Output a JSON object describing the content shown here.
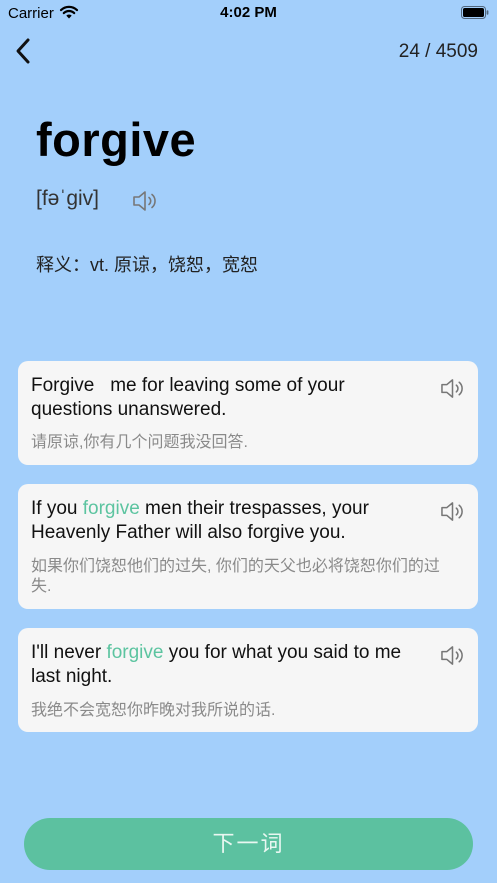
{
  "status_bar": {
    "carrier": "Carrier",
    "time": "4:02 PM"
  },
  "header": {
    "counter": "24 / 4509"
  },
  "word": {
    "text": "forgive",
    "phonetic": "[fəˈgiv]",
    "meaning_label": "释义：",
    "meaning_text": "vt. 原谅，饶恕，宽恕"
  },
  "examples": [
    {
      "en_before": "Forgive",
      "en_highlight": "",
      "en_after": "me  for leaving some of your questions unanswered.",
      "zh": "请原谅,你有几个问题我没回答."
    },
    {
      "en_before": "If you ",
      "en_highlight": "forgive",
      "en_after": " men their trespasses, your Heavenly Father will also forgive you.",
      "zh": "如果你们饶恕他们的过失, 你们的天父也必将饶恕你们的过失."
    },
    {
      "en_before": "I'll never ",
      "en_highlight": "forgive",
      "en_after": " you for what you said to me last night.",
      "zh": "我绝不会宽恕你昨晚对我所说的话."
    }
  ],
  "next_button": {
    "label": "下一词"
  },
  "colors": {
    "background": "#a3cffb",
    "accent": "#5cc1a0",
    "card": "#f6f6f6"
  },
  "icons": [
    "back-chevron-icon",
    "speaker-icon",
    "wifi-icon",
    "battery-icon"
  ]
}
